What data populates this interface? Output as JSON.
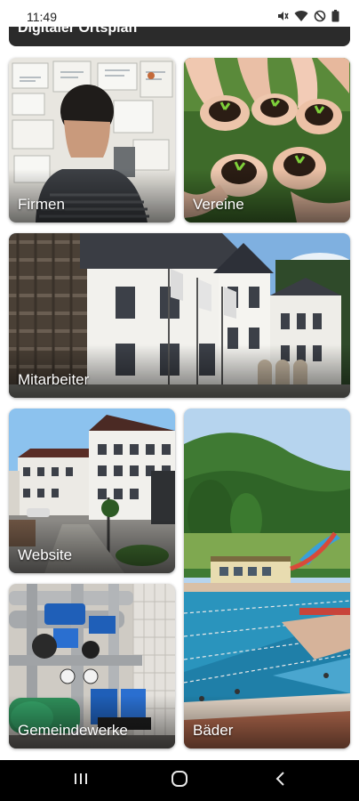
{
  "status_bar": {
    "time": "11:49",
    "icons": [
      "mute-icon",
      "wifi-icon",
      "do-not-disturb-icon",
      "battery-icon"
    ]
  },
  "top_card": {
    "label": "Digitaler Ortsplan"
  },
  "tiles": [
    {
      "label": "Firmen",
      "image": "office-worker-photo"
    },
    {
      "label": "Vereine",
      "image": "hands-holding-plants-photo"
    },
    {
      "label": "Mitarbeiter",
      "image": "town-hall-building-photo"
    },
    {
      "label": "Website",
      "image": "town-street-photo"
    },
    {
      "label": "Bäder",
      "image": "outdoor-swimming-pool-photo"
    },
    {
      "label": "Gemeindewerke",
      "image": "water-pipes-pumps-photo"
    }
  ],
  "nav_bar": {
    "buttons": [
      "recent-apps-icon",
      "home-icon",
      "back-icon"
    ]
  },
  "colors": {
    "tile_label": "#ffffff",
    "nav_background": "#000000"
  }
}
